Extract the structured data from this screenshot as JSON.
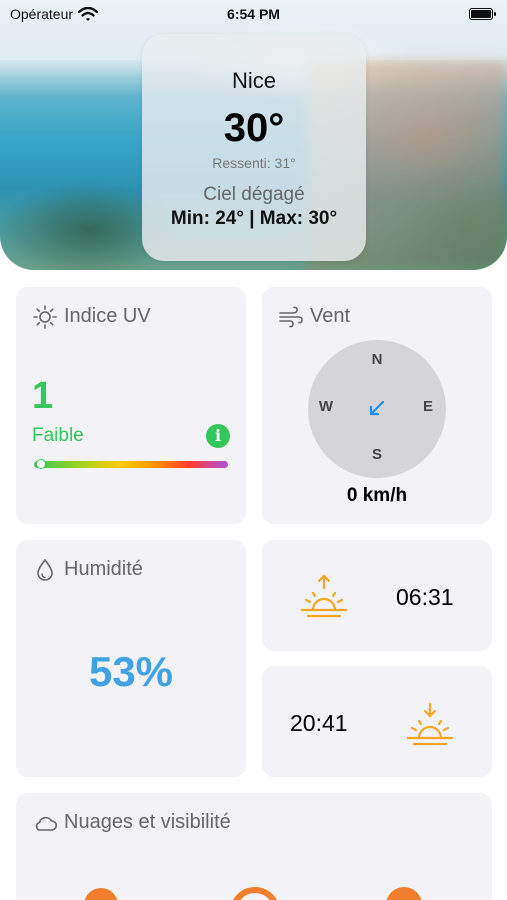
{
  "status_bar": {
    "carrier": "Opérateur",
    "time": "6:54 PM"
  },
  "header": {
    "city": "Nice",
    "temperature": "30°",
    "feels_like": "Ressenti: 31°",
    "condition": "Ciel dégagé",
    "min_max": "Min: 24° | Max: 30°"
  },
  "uv": {
    "title": "Indice UV",
    "value": "1",
    "level": "Faible",
    "info_icon": "i",
    "scale_position": 0.05
  },
  "wind": {
    "title": "Vent",
    "north": "N",
    "south": "S",
    "west": "W",
    "east": "E",
    "speed": "0 km/h"
  },
  "humidity": {
    "title": "Humidité",
    "value": "53%"
  },
  "sunrise": {
    "time": "06:31"
  },
  "sunset": {
    "time": "20:41"
  },
  "clouds": {
    "title": "Nuages et visibilité"
  },
  "colors": {
    "green": "#34c759",
    "blue": "#3ea2e5",
    "sun": "#f5a623",
    "card": "#f2f2f7"
  }
}
